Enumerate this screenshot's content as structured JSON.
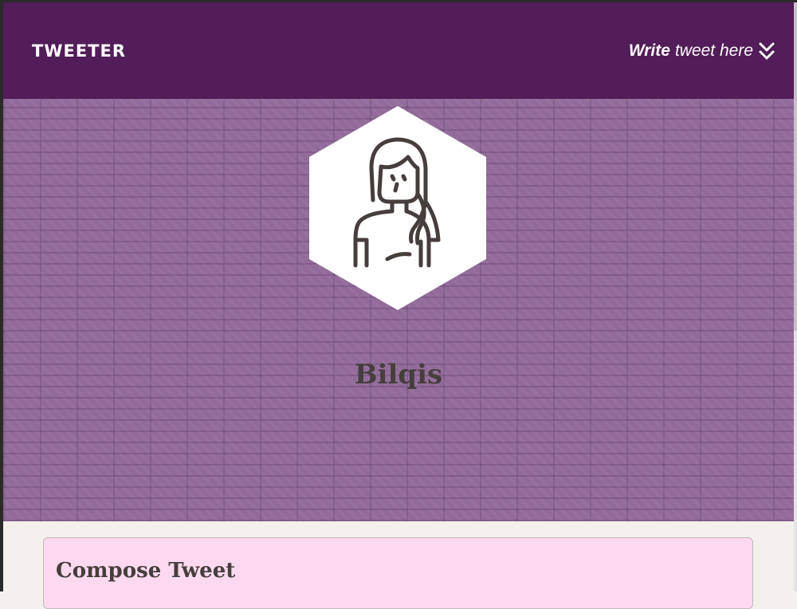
{
  "navbar": {
    "brand": "TWEETER",
    "compose_toggle": {
      "strong": "Write",
      "rest": "tweet here",
      "icon": "chevron-double-down-icon"
    }
  },
  "profile": {
    "avatar_icon": "woman-avatar-icon",
    "name": "Bilqis"
  },
  "compose": {
    "title": "Compose Tweet"
  },
  "colors": {
    "nav_bg": "#521d58",
    "hero_bg": "#936b9a",
    "page_bg": "#f4f1ec",
    "card_bg": "#fdd9f0",
    "text_dark": "#463e3c"
  }
}
